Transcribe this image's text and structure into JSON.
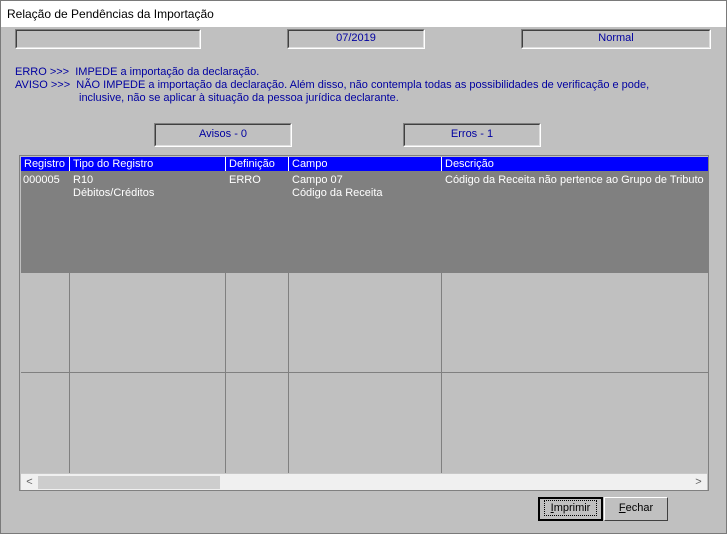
{
  "window": {
    "title": "Relação de Pendências da Importação"
  },
  "status": {
    "field1": "",
    "period": "07/2019",
    "mode": "Normal"
  },
  "legend": {
    "erro_label": "ERRO  >>>",
    "erro_text": "IMPEDE a importação da declaração.",
    "aviso_label": "AVISO  >>>",
    "aviso_text1": "NÃO IMPEDE a importação da declaração. Além disso, não contempla  todas as possibilidades de verificação e pode,",
    "aviso_text2": "inclusive, não se aplicar  à situação da pessoa jurídica declarante."
  },
  "counters": {
    "avisos": "Avisos - 0",
    "erros": "Erros - 1"
  },
  "table": {
    "headers": [
      "Registro",
      "Tipo do Registro",
      "Definição",
      "Campo",
      "Descrição"
    ],
    "rows": [
      {
        "registro": "000005",
        "tipo_line1": "R10",
        "tipo_line2": "Débitos/Créditos",
        "definicao": "ERRO",
        "campo_line1": "Campo 07",
        "campo_line2": "Código da Receita",
        "descricao": "Código da Receita  não pertence ao Grupo de Tributo i"
      }
    ]
  },
  "scrollbar": {
    "left_arrow": "<",
    "right_arrow": ">"
  },
  "buttons": {
    "imprimir_key": "I",
    "imprimir_rest": "mprimir",
    "fechar_key": "F",
    "fechar_rest": "echar"
  }
}
